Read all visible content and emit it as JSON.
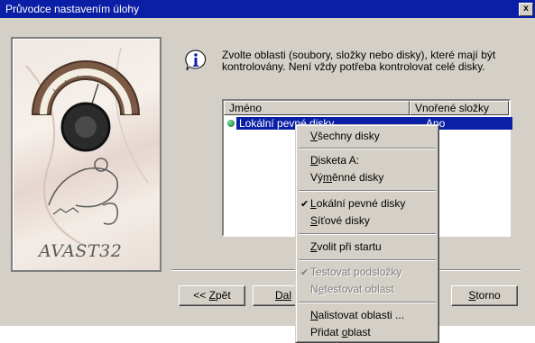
{
  "window": {
    "title": "Průvodce nastavením úlohy",
    "close_glyph": "x"
  },
  "logo": {
    "text": "AVAST32"
  },
  "info": {
    "icon": "info-icon",
    "text": "Zvolte oblasti (soubory, složky nebo disky), které mají být kontrolovány. Není vždy potřeba kontrolovat celé disky."
  },
  "list": {
    "columns": [
      "Jméno",
      "Vnořené složky"
    ],
    "rows": [
      {
        "name": "Lokální pevné disky",
        "subfolders": "Ano"
      }
    ]
  },
  "buttons": {
    "back": "<< Zpět",
    "back_prefix": "<< ",
    "back_key": "Z",
    "back_rest": "pět",
    "next_prefix": "Dal",
    "cancel_key": "S",
    "cancel_rest": "torno"
  },
  "context_menu": {
    "items": [
      {
        "label": "Všechny disky",
        "key": "V",
        "rest": "šechny disky",
        "enabled": true,
        "checked": false
      },
      {
        "label": "Disketa A:",
        "key": "D",
        "rest": "isketa A:",
        "enabled": true,
        "checked": false
      },
      {
        "label": "Výměnné disky",
        "pre": "Vý",
        "key": "m",
        "rest": "ěnné disky",
        "enabled": true,
        "checked": false
      },
      {
        "label": "Lokální pevné disky",
        "key": "L",
        "rest": "okální pevné disky",
        "enabled": true,
        "checked": true
      },
      {
        "label": "Síťové disky",
        "key": "S",
        "rest": "íťové disky",
        "enabled": true,
        "checked": false
      },
      {
        "label": "Zvolit při startu",
        "key": "Z",
        "rest": "volit při startu",
        "enabled": true,
        "checked": false
      },
      {
        "label": "Testovat podsložky",
        "enabled": false,
        "checked": true
      },
      {
        "label": "Netestovat oblast",
        "pre": "N",
        "key": "e",
        "rest": "testovat oblast",
        "enabled": false,
        "checked": false
      },
      {
        "label": "Nalistovat oblasti ...",
        "key": "N",
        "rest": "alistovat oblasti ...",
        "enabled": true,
        "checked": false
      },
      {
        "label": "Přidat oblast",
        "pre": "Přidat ",
        "key": "o",
        "rest": "blast",
        "enabled": true,
        "checked": false
      }
    ],
    "check_glyph": "✔"
  }
}
